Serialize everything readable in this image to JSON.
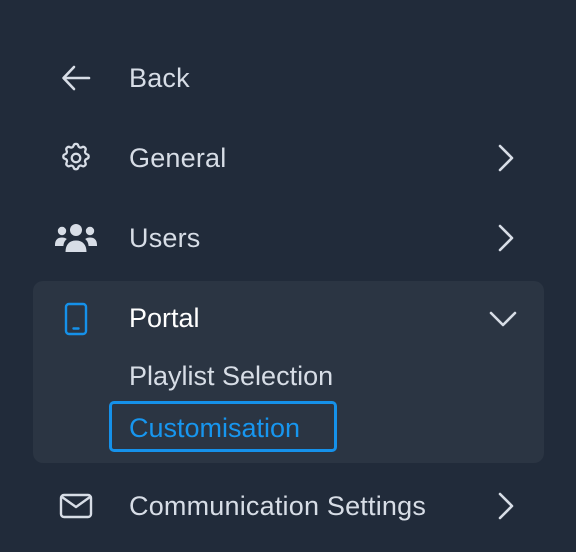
{
  "nav": {
    "back": {
      "label": "Back",
      "icon": "arrow-left-icon"
    },
    "general": {
      "label": "General",
      "icon": "gear-icon"
    },
    "users": {
      "label": "Users",
      "icon": "users-icon"
    },
    "portal": {
      "label": "Portal",
      "icon": "mobile-device-icon",
      "expanded": true,
      "items": [
        {
          "label": "Playlist Selection",
          "selected": false
        },
        {
          "label": "Customisation",
          "selected": true
        }
      ]
    },
    "communication": {
      "label": "Communication Settings",
      "icon": "envelope-icon"
    }
  },
  "colors": {
    "background": "#212b3a",
    "group_background": "#2b3543",
    "text": "#d7dde6",
    "accent": "#1591ea"
  }
}
